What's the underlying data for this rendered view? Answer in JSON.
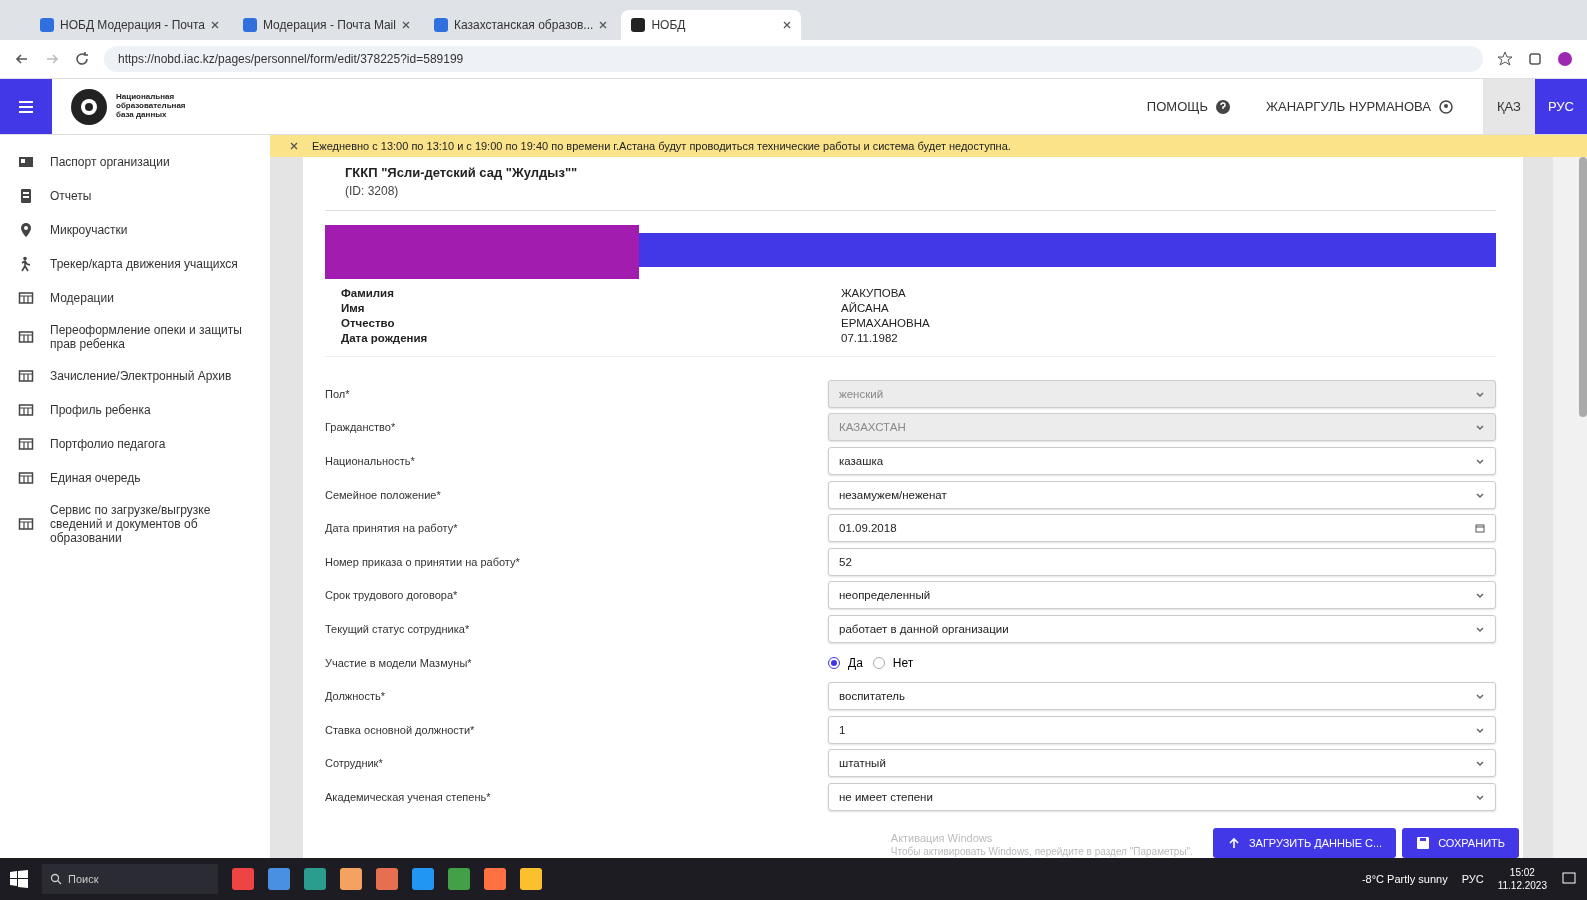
{
  "browser": {
    "tabs": [
      {
        "title": "НОБД Модерация - Почта",
        "selected": false
      },
      {
        "title": "Модерация - Почта Mail",
        "selected": false
      },
      {
        "title": "Казахстанская образов...",
        "selected": false
      },
      {
        "title": "НОБД",
        "selected": true
      }
    ],
    "address": "https://nobd.iac.kz/pages/personnel/form/edit/378225?id=589199"
  },
  "header": {
    "logo_text": "Национальная образовательная база данных",
    "help": "ПОМОЩЬ",
    "user": "ЖАНАРГУЛЬ НУРМАНОВА",
    "languages": [
      {
        "label": "ҚАЗ",
        "selected": false
      },
      {
        "label": "РУС",
        "selected": true
      }
    ]
  },
  "sidebar": {
    "items": [
      {
        "label": "Паспорт организации",
        "kind": "passport"
      },
      {
        "label": "Отчеты",
        "kind": "report"
      },
      {
        "label": "Микроучастки",
        "kind": "pin"
      },
      {
        "label": "Трекер/карта движения учащихся",
        "kind": "person"
      },
      {
        "label": "Модерации",
        "kind": "table"
      },
      {
        "label": "Переоформление опеки и защиты прав ребенка",
        "kind": "table"
      },
      {
        "label": "Зачисление/Электронный Архив",
        "kind": "table"
      },
      {
        "label": "Профиль ребенка",
        "kind": "table"
      },
      {
        "label": "Портфолио педагога",
        "kind": "table"
      },
      {
        "label": "Единая очередь",
        "kind": "table"
      },
      {
        "label": "Сервис по загрузке/выгрузке сведений и документов об образовании",
        "kind": "table"
      }
    ]
  },
  "banner": "Ежедневно с 13:00 по 13:10 и с 19:00 по 19:40 по времени г.Астана будут проводиться технические работы и система будет недоступна.",
  "organization": {
    "name": "ГККП \"Ясли-детский сад \"Жулдыз\"\"",
    "id": "(ID: 3208)"
  },
  "person": [
    {
      "label": "Фамилия",
      "value": "ЖАКУПОВА"
    },
    {
      "label": "Имя",
      "value": "АЙСАНА"
    },
    {
      "label": "Отчество",
      "value": "ЕРМАХАНОВНА"
    },
    {
      "label": "Дата рождения",
      "value": "07.11.1982"
    }
  ],
  "form": [
    {
      "label": "Пол*",
      "kind": "select",
      "value": "женский",
      "disabled": true
    },
    {
      "label": "Гражданство*",
      "kind": "select",
      "value": "КАЗАХСТАН",
      "disabled": true
    },
    {
      "label": "Национальность*",
      "kind": "select",
      "value": "казашка",
      "disabled": false
    },
    {
      "label": "Семейное положение*",
      "kind": "select",
      "value": "незамужем/неженат",
      "disabled": false
    },
    {
      "label": "Дата принятия на работу*",
      "kind": "date",
      "value": "01.09.2018",
      "disabled": false
    },
    {
      "label": "Номер приказа о принятии на работу*",
      "kind": "text",
      "value": "52",
      "disabled": false
    },
    {
      "label": "Срок трудового договора*",
      "kind": "select",
      "value": "неопределенный",
      "disabled": false
    },
    {
      "label": "Текущий статус сотрудника*",
      "kind": "select",
      "value": "работает в данной организации",
      "disabled": false
    },
    {
      "label": "Участие в модели Мазмуны*",
      "kind": "radio",
      "options": [
        {
          "label": "Да",
          "selected": true
        },
        {
          "label": "Нет",
          "selected": false
        }
      ]
    },
    {
      "label": "Должность*",
      "kind": "select",
      "value": "воспитатель",
      "disabled": false
    },
    {
      "label": "Ставка основной должности*",
      "kind": "select",
      "value": "1",
      "disabled": false
    },
    {
      "label": "Сотрудник*",
      "kind": "select",
      "value": "штатный",
      "disabled": false
    },
    {
      "label": "Академическая ученая степень*",
      "kind": "select",
      "value": "не имеет степени",
      "disabled": false
    }
  ],
  "actions": [
    {
      "label": "ЗАГРУЗИТЬ ДАННЫЕ С...",
      "kind": "upload"
    },
    {
      "label": "СОХРАНИТЬ",
      "kind": "save"
    }
  ],
  "activation": {
    "title": "Активация Windows",
    "text": "Чтобы активировать Windows, перейдите в раздел \"Параметры\"."
  },
  "taskbar": {
    "search": "Поиск",
    "weather": "-8°C Partly sunny",
    "language": "РУС",
    "time": "15:02",
    "date": "11.12.2023"
  }
}
